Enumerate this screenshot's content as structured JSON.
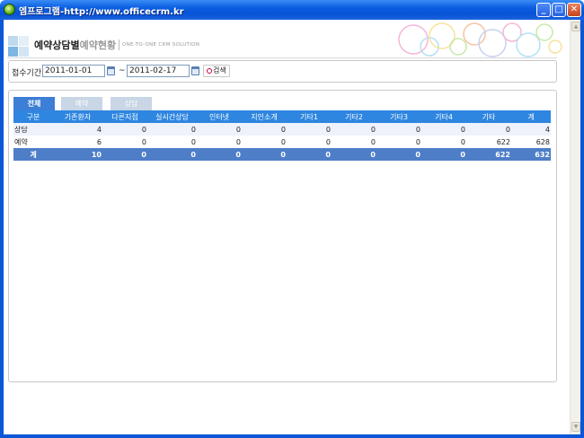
{
  "window": {
    "title": "엠프로그램-http://www.officecrm.kr"
  },
  "header": {
    "title_main": "예약상담별",
    "title_sub": "예약현황",
    "slogan": "ONE-TO-ONE CRM SOLUTION"
  },
  "search": {
    "label": "접수기간",
    "start_date": "2011-01-01",
    "tilde": "~",
    "end_date": "2011-02-17",
    "button_label": "검색"
  },
  "tabs": [
    {
      "label": "전체",
      "active": true
    },
    {
      "label": "예약",
      "active": false
    },
    {
      "label": "상담",
      "active": false
    }
  ],
  "table": {
    "columns": [
      "구분",
      "기존환자",
      "다른지점",
      "실시간상담",
      "인터넷",
      "지인소개",
      "기타1",
      "기타2",
      "기타3",
      "기타4",
      "기타",
      "계"
    ],
    "rows": [
      {
        "label": "상담",
        "values": [
          "4",
          "0",
          "0",
          "0",
          "0",
          "0",
          "0",
          "0",
          "0",
          "0",
          "4"
        ]
      },
      {
        "label": "예약",
        "values": [
          "6",
          "0",
          "0",
          "0",
          "0",
          "0",
          "0",
          "0",
          "0",
          "622",
          "628"
        ]
      }
    ],
    "total": {
      "label": "계",
      "values": [
        "10",
        "0",
        "0",
        "0",
        "0",
        "0",
        "0",
        "0",
        "0",
        "622",
        "632"
      ]
    }
  },
  "colors": {
    "titlebar": "#0a5ee0",
    "table_header": "#2e86e0",
    "total_row": "#4e7ec8",
    "active_tab": "#3d7ed6",
    "inactive_tab": "#c8d6e5"
  }
}
